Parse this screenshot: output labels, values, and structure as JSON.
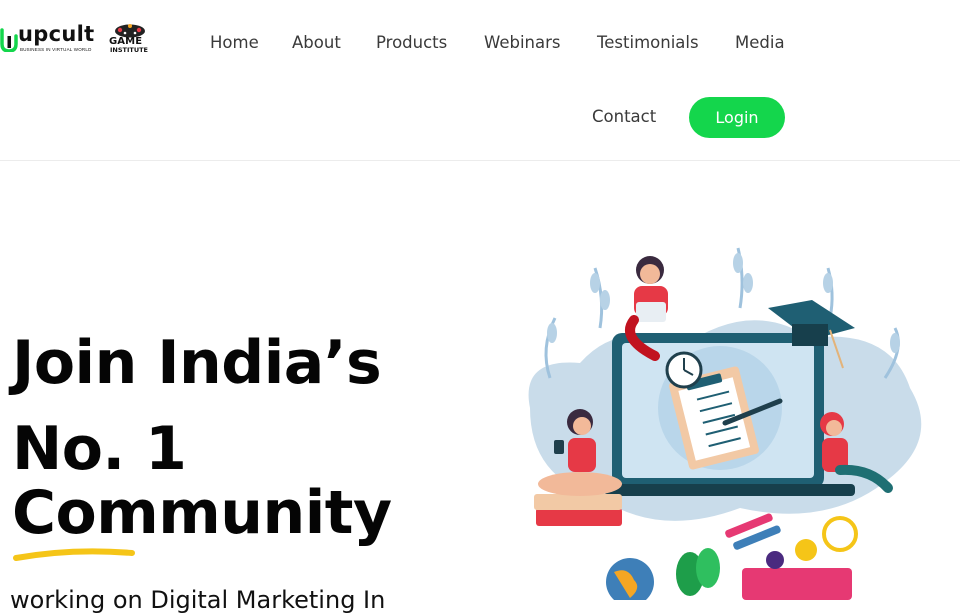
{
  "brand": {
    "name": "upcult",
    "tagline": "BUSINESS IN VIRTUAL WORLD",
    "partner_top": "GAME",
    "partner_bottom": "INSTITUTE",
    "accent_color": "#14d64c",
    "underline_color": "#f5c518"
  },
  "nav": {
    "items": [
      "Home",
      "About",
      "Products",
      "Webinars",
      "Testimonials",
      "Media",
      "Contact"
    ],
    "login_label": "Login"
  },
  "hero": {
    "line1": "Join India’s",
    "line2": "No. 1",
    "line3": "Community",
    "subtitle": "working on Digital Marketing In"
  },
  "illustration": {
    "icon": "online-learning-illustration"
  }
}
